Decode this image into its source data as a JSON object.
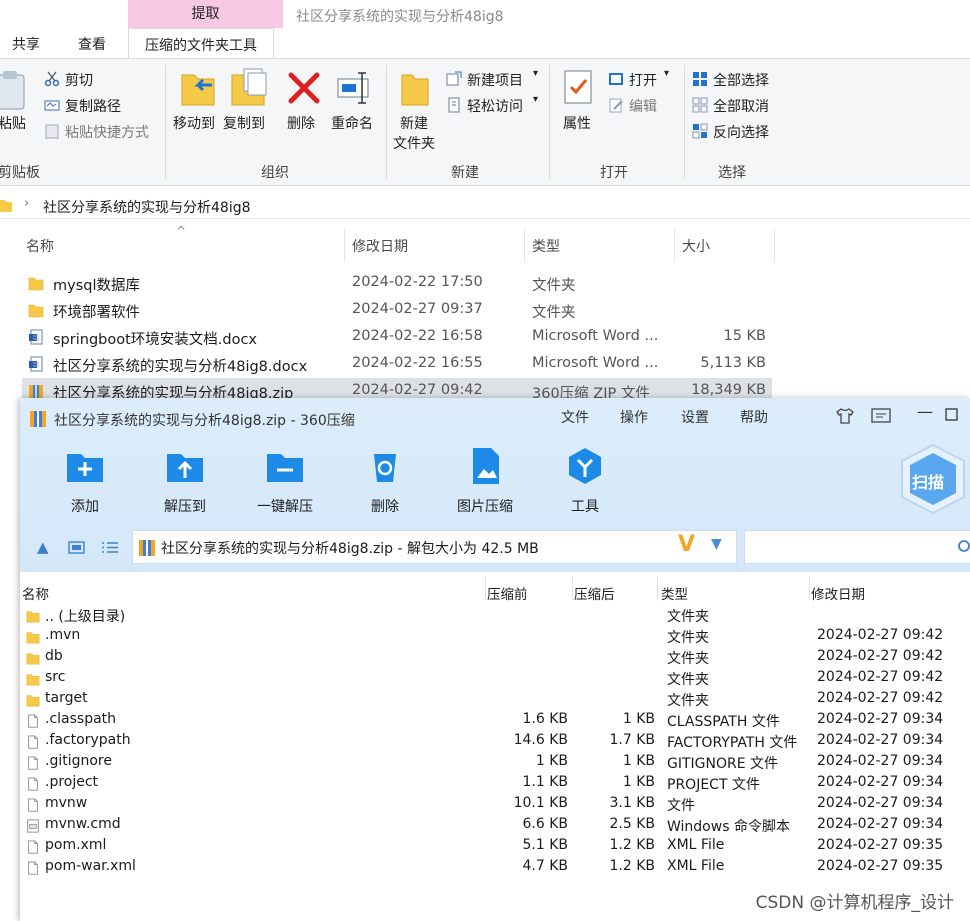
{
  "explorer": {
    "context_tab": "提取",
    "window_title": "社区分享系统的实现与分析48ig8",
    "tabs": [
      "共享",
      "查看",
      "压缩的文件夹工具"
    ],
    "ribbon": {
      "paste": "粘贴",
      "cut": "剪切",
      "copy_path": "复制路径",
      "paste_shortcut": "粘贴快捷方式",
      "clipboard_group": "剪贴板",
      "move_to": "移动到",
      "copy_to": "复制到",
      "delete": "删除",
      "rename": "重命名",
      "organize_group": "组织",
      "new_folder_line1": "新建",
      "new_folder_line2": "文件夹",
      "new_item": "新建项目",
      "easy_access": "轻松访问",
      "new_group": "新建",
      "properties": "属性",
      "open": "打开",
      "edit": "编辑",
      "open_group": "打开",
      "select_all": "全部选择",
      "select_none": "全部取消",
      "invert_selection": "反向选择",
      "select_group": "选择"
    },
    "address": "社区分享系统的实现与分析48ig8",
    "columns": {
      "name": "名称",
      "modified": "修改日期",
      "type": "类型",
      "size": "大小"
    },
    "files": [
      {
        "name": "mysql数据库",
        "modified": "2024-02-22 17:50",
        "type": "文件夹",
        "size": "",
        "icon": "folder-icon"
      },
      {
        "name": "环境部署软件",
        "modified": "2024-02-27 09:37",
        "type": "文件夹",
        "size": "",
        "icon": "folder-icon"
      },
      {
        "name": "springboot环境安装文档.docx",
        "modified": "2024-02-22 16:58",
        "type": "Microsoft Word ...",
        "size": "15 KB",
        "icon": "word-doc-icon"
      },
      {
        "name": "社区分享系统的实现与分析48ig8.docx",
        "modified": "2024-02-22 16:55",
        "type": "Microsoft Word ...",
        "size": "5,113 KB",
        "icon": "word-doc-icon"
      },
      {
        "name": "社区分享系统的实现与分析48ig8.zip",
        "modified": "2024-02-27 09:42",
        "type": "360压缩 ZIP 文件",
        "size": "18,349 KB",
        "icon": "zip-archive-icon"
      }
    ]
  },
  "zip": {
    "title": "社区分享系统的实现与分析48ig8.zip - 360压缩",
    "menu": [
      "文件",
      "操作",
      "设置",
      "帮助"
    ],
    "tools": [
      "添加",
      "解压到",
      "一键解压",
      "删除",
      "图片压缩",
      "工具"
    ],
    "scan": "扫描",
    "path_text": "社区分享系统的实现与分析48ig8.zip - 解包大小为 42.5 MB",
    "columns": {
      "name": "名称",
      "before": "压缩前",
      "after": "压缩后",
      "type": "类型",
      "modified": "修改日期"
    },
    "files": [
      {
        "name": ".. (上级目录)",
        "before": "",
        "after": "",
        "type": "文件夹",
        "modified": "",
        "icon": "folder-icon"
      },
      {
        "name": ".mvn",
        "before": "",
        "after": "",
        "type": "文件夹",
        "modified": "2024-02-27 09:42",
        "icon": "folder-icon"
      },
      {
        "name": "db",
        "before": "",
        "after": "",
        "type": "文件夹",
        "modified": "2024-02-27 09:42",
        "icon": "folder-icon"
      },
      {
        "name": "src",
        "before": "",
        "after": "",
        "type": "文件夹",
        "modified": "2024-02-27 09:42",
        "icon": "folder-icon"
      },
      {
        "name": "target",
        "before": "",
        "after": "",
        "type": "文件夹",
        "modified": "2024-02-27 09:42",
        "icon": "folder-icon"
      },
      {
        "name": ".classpath",
        "before": "1.6 KB",
        "after": "1 KB",
        "type": "CLASSPATH 文件",
        "modified": "2024-02-27 09:34",
        "icon": "file-icon"
      },
      {
        "name": ".factorypath",
        "before": "14.6 KB",
        "after": "1.7 KB",
        "type": "FACTORYPATH 文件",
        "modified": "2024-02-27 09:34",
        "icon": "file-icon"
      },
      {
        "name": ".gitignore",
        "before": "1 KB",
        "after": "1 KB",
        "type": "GITIGNORE 文件",
        "modified": "2024-02-27 09:34",
        "icon": "file-icon"
      },
      {
        "name": ".project",
        "before": "1.1 KB",
        "after": "1 KB",
        "type": "PROJECT 文件",
        "modified": "2024-02-27 09:34",
        "icon": "file-icon"
      },
      {
        "name": "mvnw",
        "before": "10.1 KB",
        "after": "3.1 KB",
        "type": "文件",
        "modified": "2024-02-27 09:34",
        "icon": "file-icon"
      },
      {
        "name": "mvnw.cmd",
        "before": "6.6 KB",
        "after": "2.5 KB",
        "type": "Windows 命令脚本",
        "modified": "2024-02-27 09:34",
        "icon": "script-icon"
      },
      {
        "name": "pom.xml",
        "before": "5.1 KB",
        "after": "1.2 KB",
        "type": "XML File",
        "modified": "2024-02-27 09:35",
        "icon": "file-icon"
      },
      {
        "name": "pom-war.xml",
        "before": "4.7 KB",
        "after": "1.2 KB",
        "type": "XML File",
        "modified": "2024-02-27 09:35",
        "icon": "file-icon"
      }
    ]
  },
  "watermark": "CSDN @计算机程序_设计"
}
